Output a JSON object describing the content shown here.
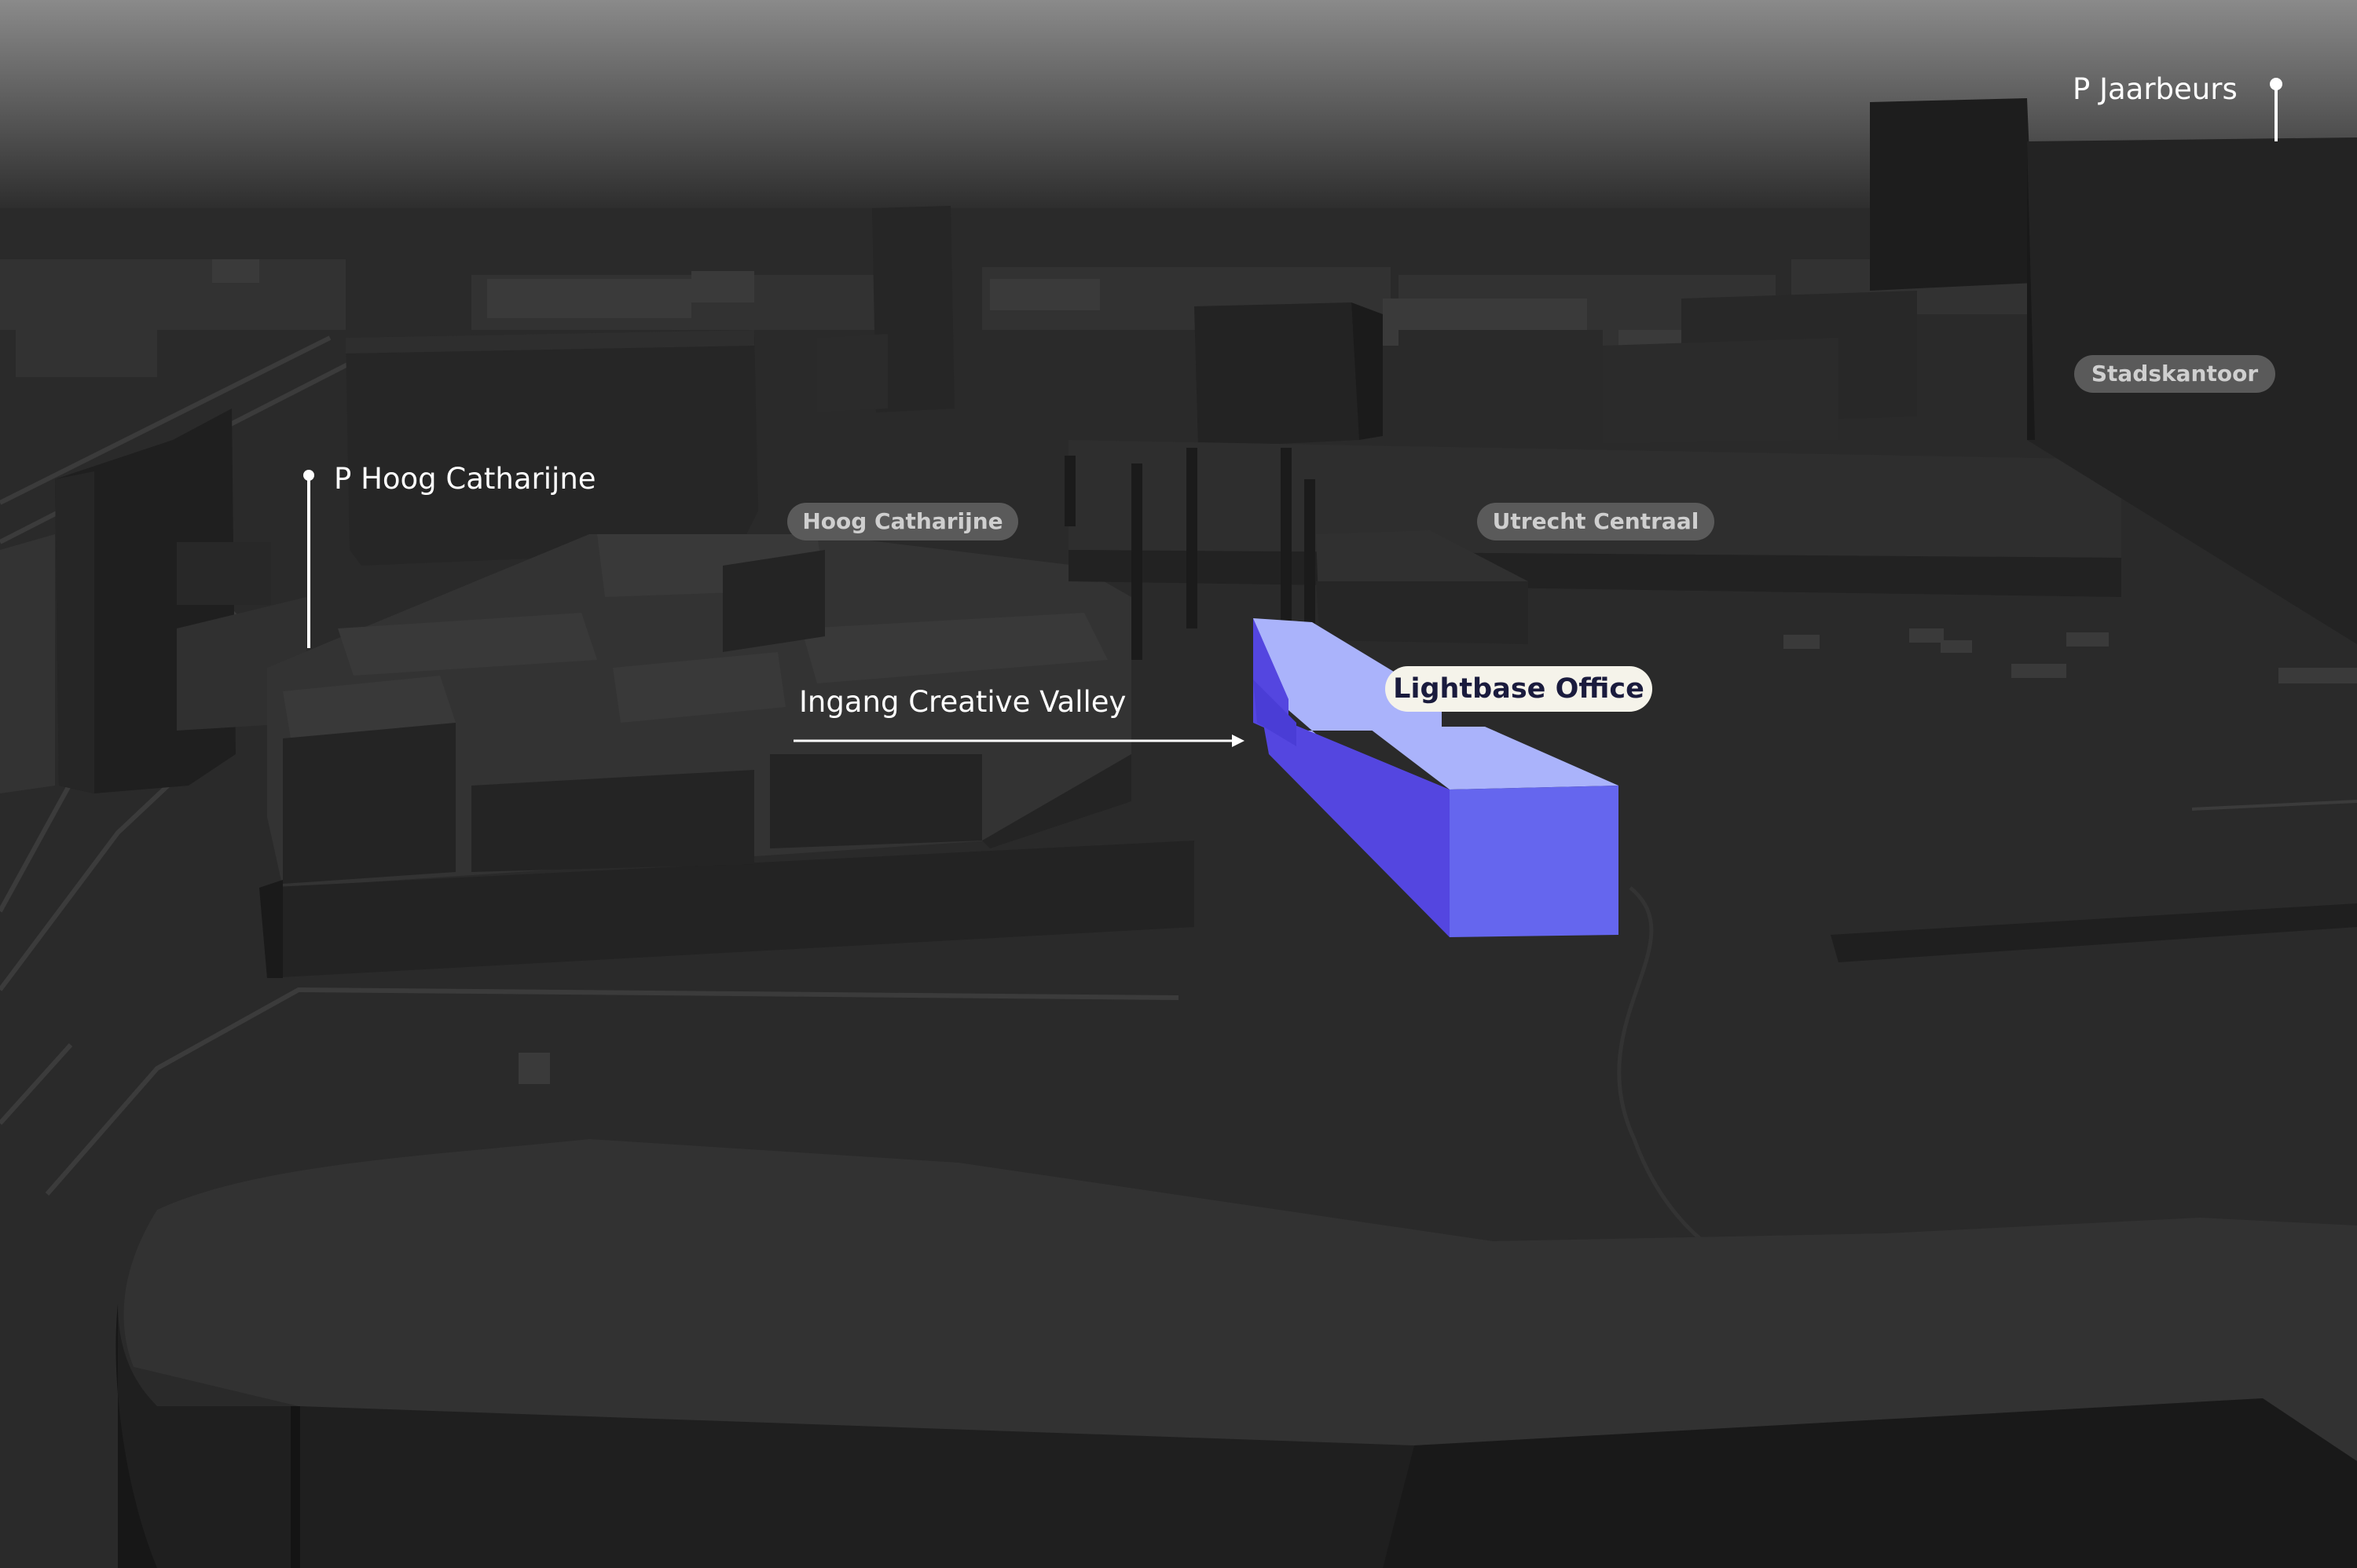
{
  "map": {
    "style": "dark 3D buildings",
    "colors": {
      "sky_top": "#8a8a8a",
      "sky_bottom": "#2c2c2c",
      "ground": "#2a2a2a",
      "building_dark": "#1e1e1e",
      "building_mid": "#303030",
      "building_light": "#3a3a3a",
      "highlight_top": "#aab3fb",
      "highlight_front": "#6566ee",
      "highlight_side": "#5446e0",
      "pill_gray": "#5a5a5a",
      "pill_text": "#cfcfcf",
      "pill_highlight": "#f5f3ea",
      "pill_highlight_text": "#1a1b3d",
      "callout_text": "#ffffff"
    }
  },
  "labels": {
    "hoog_catharijne": "Hoog Catharijne",
    "utrecht_centraal": "Utrecht Centraal",
    "stadskantoor": "Stadskantoor",
    "lightbase_office": "Lightbase Office"
  },
  "callouts": {
    "p_hoog_catharijne": "P Hoog Catharijne",
    "ingang_creative_valley": "Ingang Creative Valley",
    "p_jaarbeurs": "P Jaarbeurs"
  }
}
